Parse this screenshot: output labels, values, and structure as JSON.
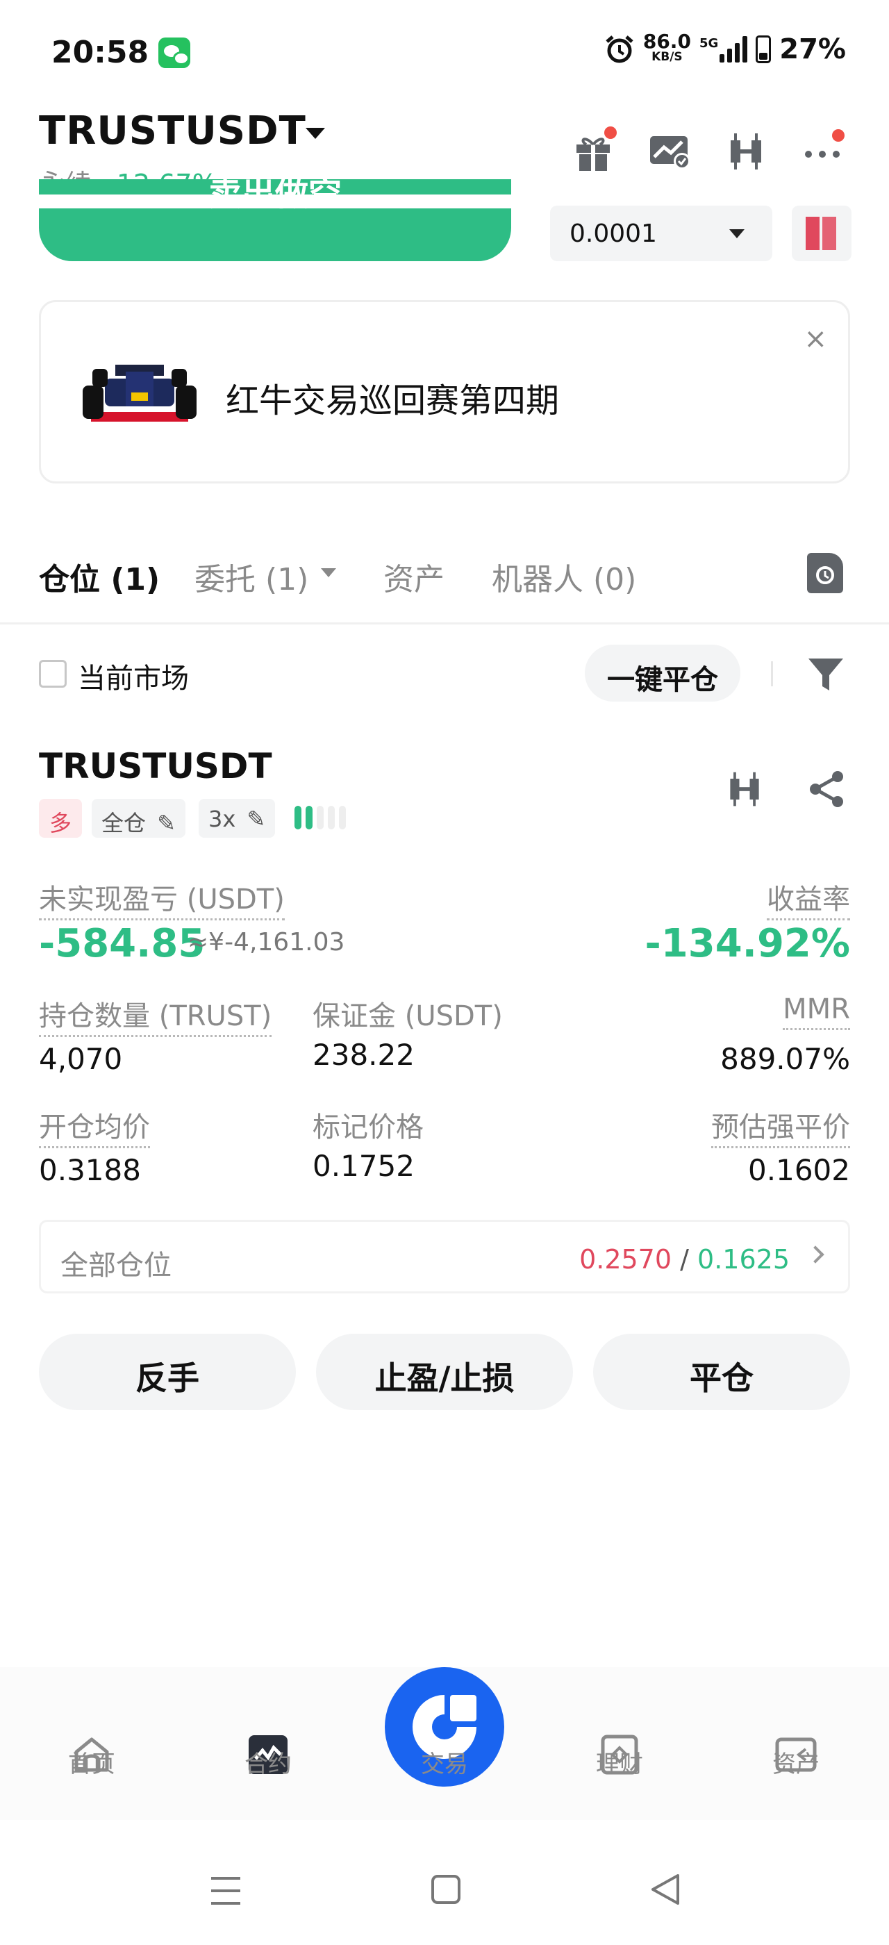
{
  "status_bar": {
    "time": "20:58",
    "net_speed": "86.0",
    "net_unit": "KB/S",
    "network_type": "5G",
    "battery": "27%"
  },
  "header": {
    "pair": "TRUSTUSDT",
    "contract_type": "永续",
    "change": "-12.67%",
    "icons": [
      "gift-icon",
      "chart-check-icon",
      "candlestick-icon",
      "more-icon"
    ]
  },
  "order": {
    "sell_label": "卖出做空",
    "precision": "0.0001"
  },
  "banner": {
    "text": "红牛交易巡回赛第四期",
    "close": "×"
  },
  "tabs": [
    {
      "label": "仓位 (1)"
    },
    {
      "label": "委托 (1)"
    },
    {
      "label": "资产"
    },
    {
      "label": "机器人 (0)"
    }
  ],
  "filter": {
    "current_market": "当前市场",
    "close_all": "一键平仓"
  },
  "position": {
    "symbol": "TRUSTUSDT",
    "side": "多",
    "margin_mode": "全仓",
    "leverage": "3x",
    "risk_level": 2,
    "unrealized_pnl_label": "未实现盈亏 (USDT)",
    "unrealized_pnl": "-584.85",
    "unrealized_pnl_cny": "≈¥-4,161.03",
    "roi_label": "收益率",
    "roi": "-134.92%",
    "size_label": "持仓数量 (TRUST)",
    "size": "4,070",
    "margin_label": "保证金 (USDT)",
    "margin": "238.22",
    "mmr_label": "MMR",
    "mmr": "889.07%",
    "entry_label": "开仓均价",
    "entry": "0.3188",
    "mark_label": "标记价格",
    "mark": "0.1752",
    "liq_label": "预估强平价",
    "liq": "0.1602"
  },
  "all_positions": {
    "label": "全部仓位",
    "value_red": "0.2570",
    "separator": "/",
    "value_green": "0.1625"
  },
  "actions": {
    "reverse": "反手",
    "tp_sl": "止盈/止损",
    "close": "平仓"
  },
  "bottom_nav": [
    {
      "label": "首页"
    },
    {
      "label": "合约"
    },
    {
      "label": "交易"
    },
    {
      "label": "理财"
    },
    {
      "label": "资产"
    }
  ],
  "colors": {
    "green": "#2ebd85",
    "red": "#e0485d",
    "orange": "#f39a3c",
    "brand_blue": "#1a64f0"
  }
}
